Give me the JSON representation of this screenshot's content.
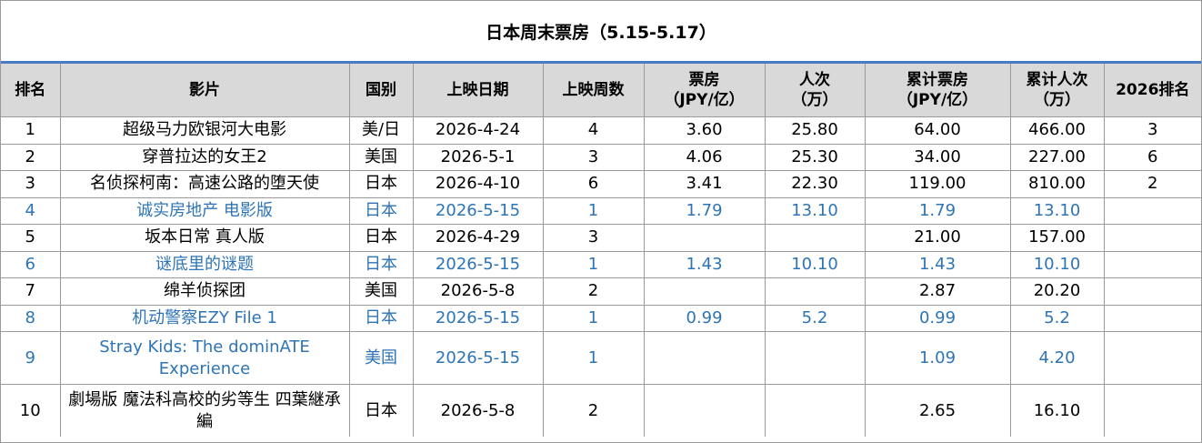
{
  "title": "日本周末票房（5.15-5.17）",
  "headers": [
    {
      "main": "排名",
      "sub": ""
    },
    {
      "main": "影片",
      "sub": ""
    },
    {
      "main": "国别",
      "sub": ""
    },
    {
      "main": "上映日期",
      "sub": ""
    },
    {
      "main": "上映周数",
      "sub": ""
    },
    {
      "main": "票房",
      "sub": "（JPY/亿）"
    },
    {
      "main": "人次",
      "sub": "（万）"
    },
    {
      "main": "累计票房",
      "sub": "（JPY/亿）"
    },
    {
      "main": "累计人次",
      "sub": "（万）"
    },
    {
      "main": "2026排名",
      "sub": ""
    }
  ],
  "rows": [
    {
      "rank": "1",
      "film": "超级马力欧银河大电影",
      "country": "美/日",
      "release": "2026-4-24",
      "weeks": "4",
      "gross": "3.60",
      "admissions": "25.80",
      "total_gross": "64.00",
      "total_admissions": "466.00",
      "rank_2026": "3",
      "new": false
    },
    {
      "rank": "2",
      "film": "穿普拉达的女王2",
      "country": "美国",
      "release": "2026-5-1",
      "weeks": "3",
      "gross": "4.06",
      "admissions": "25.30",
      "total_gross": "34.00",
      "total_admissions": "227.00",
      "rank_2026": "6",
      "new": false
    },
    {
      "rank": "3",
      "film": "名侦探柯南：高速公路的堕天使",
      "country": "日本",
      "release": "2026-4-10",
      "weeks": "6",
      "gross": "3.41",
      "admissions": "22.30",
      "total_gross": "119.00",
      "total_admissions": "810.00",
      "rank_2026": "2",
      "new": false
    },
    {
      "rank": "4",
      "film": "诚实房地产 电影版",
      "country": "日本",
      "release": "2026-5-15",
      "weeks": "1",
      "gross": "1.79",
      "admissions": "13.10",
      "total_gross": "1.79",
      "total_admissions": "13.10",
      "rank_2026": "",
      "new": true
    },
    {
      "rank": "5",
      "film": "坂本日常 真人版",
      "country": "日本",
      "release": "2026-4-29",
      "weeks": "3",
      "gross": "",
      "admissions": "",
      "total_gross": "21.00",
      "total_admissions": "157.00",
      "rank_2026": "",
      "new": false
    },
    {
      "rank": "6",
      "film": "谜底里的谜题",
      "country": "日本",
      "release": "2026-5-15",
      "weeks": "1",
      "gross": "1.43",
      "admissions": "10.10",
      "total_gross": "1.43",
      "total_admissions": "10.10",
      "rank_2026": "",
      "new": true
    },
    {
      "rank": "7",
      "film": "绵羊侦探团",
      "country": "美国",
      "release": "2026-5-8",
      "weeks": "2",
      "gross": "",
      "admissions": "",
      "total_gross": "2.87",
      "total_admissions": "20.20",
      "rank_2026": "",
      "new": false
    },
    {
      "rank": "8",
      "film": "机动警察EZY File 1",
      "country": "日本",
      "release": "2026-5-15",
      "weeks": "1",
      "gross": "0.99",
      "admissions": "5.2",
      "total_gross": "0.99",
      "total_admissions": "5.2",
      "rank_2026": "",
      "new": true
    },
    {
      "rank": "9",
      "film": "Stray Kids: The dominATE Experience",
      "country": "美国",
      "release": "2026-5-15",
      "weeks": "1",
      "gross": "",
      "admissions": "",
      "total_gross": "1.09",
      "total_admissions": "4.20",
      "rank_2026": "",
      "new": true,
      "tall": true
    },
    {
      "rank": "10",
      "film": "劇場版 魔法科高校的劣等生 四葉継承編",
      "country": "日本",
      "release": "2026-5-8",
      "weeks": "2",
      "gross": "",
      "admissions": "",
      "total_gross": "2.65",
      "total_admissions": "16.10",
      "rank_2026": "",
      "new": false,
      "tall": true
    }
  ]
}
